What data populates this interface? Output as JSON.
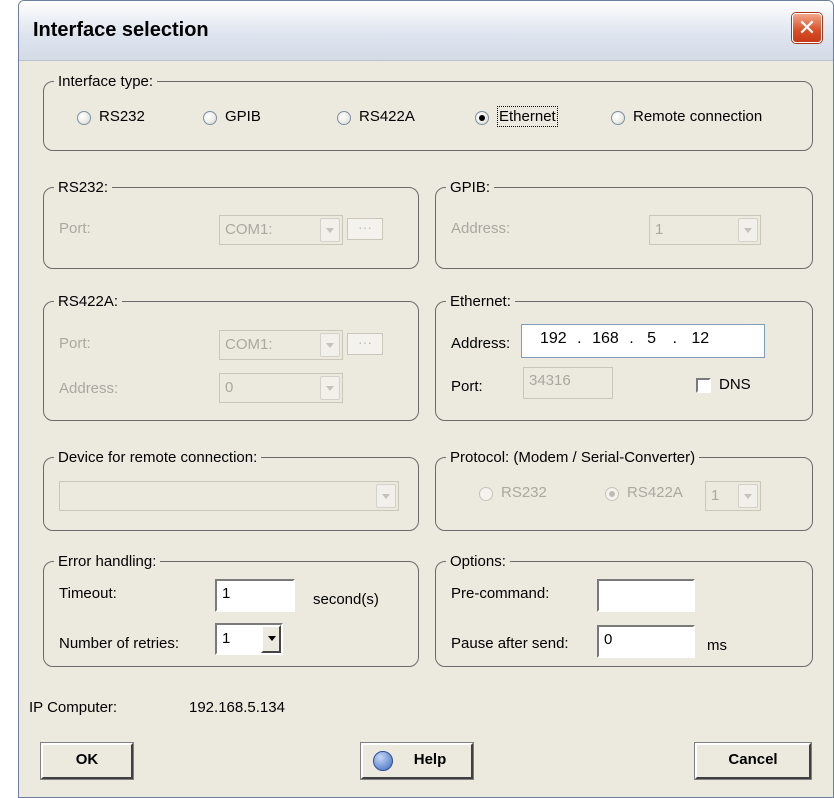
{
  "window": {
    "title": "Interface selection",
    "close_glyph": "✕"
  },
  "interface_type": {
    "legend": "Interface type:",
    "options": [
      "RS232",
      "GPIB",
      "RS422A",
      "Ethernet",
      "Remote connection"
    ],
    "selected": "Ethernet"
  },
  "rs232": {
    "legend": "RS232:",
    "port_label": "Port:",
    "port_value": "COM1:",
    "browse_label": "···"
  },
  "gpib": {
    "legend": "GPIB:",
    "address_label": "Address:",
    "address_value": "1"
  },
  "rs422a": {
    "legend": "RS422A:",
    "port_label": "Port:",
    "port_value": "COM1:",
    "browse_label": "···",
    "address_label": "Address:",
    "address_value": "0"
  },
  "ethernet": {
    "legend": "Ethernet:",
    "address_label": "Address:",
    "ip_octets": [
      "192",
      "168",
      "5",
      "12"
    ],
    "ip_separator": ".",
    "port_label": "Port:",
    "port_value": "34316",
    "dns_label": "DNS",
    "dns_checked": false
  },
  "remote_device": {
    "legend": "Device for remote connection:",
    "value": ""
  },
  "protocol": {
    "legend": "Protocol: (Modem / Serial-Converter)",
    "options": [
      "RS232",
      "RS422A"
    ],
    "selected": "RS422A",
    "unit_value": "1"
  },
  "error_handling": {
    "legend": "Error handling:",
    "timeout_label": "Timeout:",
    "timeout_value": "1",
    "timeout_unit": "second(s)",
    "retries_label": "Number of retries:",
    "retries_value": "1"
  },
  "options": {
    "legend": "Options:",
    "precommand_label": "Pre-command:",
    "precommand_value": "",
    "pause_label": "Pause after send:",
    "pause_value": "0",
    "pause_unit": "ms"
  },
  "ip_computer": {
    "label": "IP Computer:",
    "value": "192.168.5.134"
  },
  "buttons": {
    "ok": "OK",
    "help": "Help",
    "cancel": "Cancel"
  },
  "icons": {
    "help": "help-question-icon",
    "close": "close-icon",
    "dropdown": "chevron-down-icon"
  },
  "colors": {
    "dialog_bg": "#eceadf",
    "title_text": "#000000",
    "close_red": "#d84d26",
    "disabled_text": "#a9a9a0"
  }
}
